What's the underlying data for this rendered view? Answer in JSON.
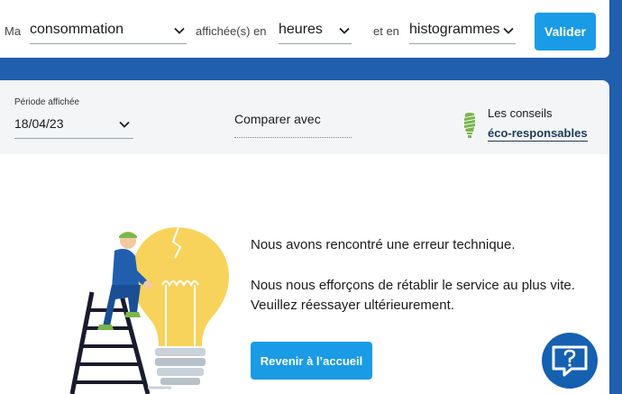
{
  "topbar": {
    "prefix": "Ma",
    "metric": "consommation",
    "shown_label": "affichée(s) en",
    "unit": "heures",
    "and_label": "et en",
    "chart_type": "histogrammes",
    "submit_label": "Valider"
  },
  "filter": {
    "period_label": "Période affichée",
    "period_value": "18/04/23",
    "compare_label": "Comparer avec",
    "tips_line1": "Les conseils",
    "tips_line2": "éco-responsables"
  },
  "error": {
    "title": "Nous avons rencontré une erreur technique.",
    "message": "Nous nous efforçons de rétablir le service au plus vite. Veuillez réessayer ultérieurement.",
    "home_button": "Revenir à l’accueil"
  },
  "colors": {
    "accent": "#1a9be6",
    "brand_blue": "#1f5fae",
    "help_blue": "#1560b0",
    "bulb_yellow": "#f7d35c",
    "leaf_green": "#7ab648"
  },
  "icons": {
    "select_chevron": "chevron-down-icon",
    "tips": "eco-bulb-icon",
    "help": "help-chat-icon"
  }
}
